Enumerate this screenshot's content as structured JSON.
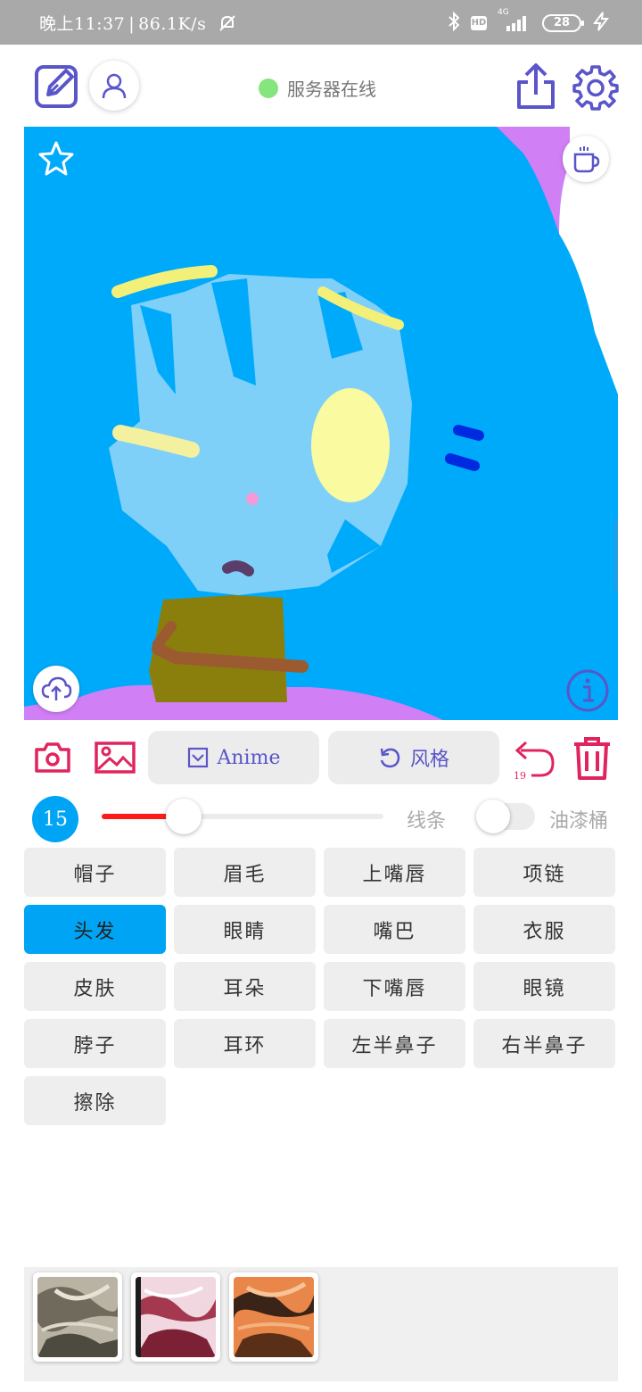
{
  "status_bar": {
    "time": "晚上11:37",
    "speed": "86.1K/s",
    "network": "4G",
    "battery": "28"
  },
  "header": {
    "server_status": "服务器在线",
    "online_color": "#86e57f"
  },
  "canvas": {
    "background_color": "#00aafa",
    "icons": [
      "star-icon",
      "coffee-cup-icon",
      "cloud-upload-icon",
      "info-icon"
    ]
  },
  "toolbar": {
    "anime_label": "Anime",
    "style_label": "风格",
    "undo_count": "19",
    "accent_color": "#e0245e",
    "brand_color": "#5a55c9"
  },
  "brush": {
    "size": "15",
    "slider_value": 0.29,
    "line_label": "线条",
    "bucket_label": "油漆桶",
    "bucket_enabled": false
  },
  "parts": [
    {
      "label": "帽子",
      "selected": false
    },
    {
      "label": "眉毛",
      "selected": false
    },
    {
      "label": "上嘴唇",
      "selected": false
    },
    {
      "label": "项链",
      "selected": false
    },
    {
      "label": "头发",
      "selected": true
    },
    {
      "label": "眼睛",
      "selected": false
    },
    {
      "label": "嘴巴",
      "selected": false
    },
    {
      "label": "衣服",
      "selected": false
    },
    {
      "label": "皮肤",
      "selected": false
    },
    {
      "label": "耳朵",
      "selected": false
    },
    {
      "label": "下嘴唇",
      "selected": false
    },
    {
      "label": "眼镜",
      "selected": false
    },
    {
      "label": "脖子",
      "selected": false
    },
    {
      "label": "耳环",
      "selected": false
    },
    {
      "label": "左半鼻子",
      "selected": false
    },
    {
      "label": "右半鼻子",
      "selected": false
    },
    {
      "label": "擦除",
      "selected": false
    }
  ],
  "style_thumbnails": [
    "style-grey",
    "style-pink",
    "style-orange"
  ]
}
